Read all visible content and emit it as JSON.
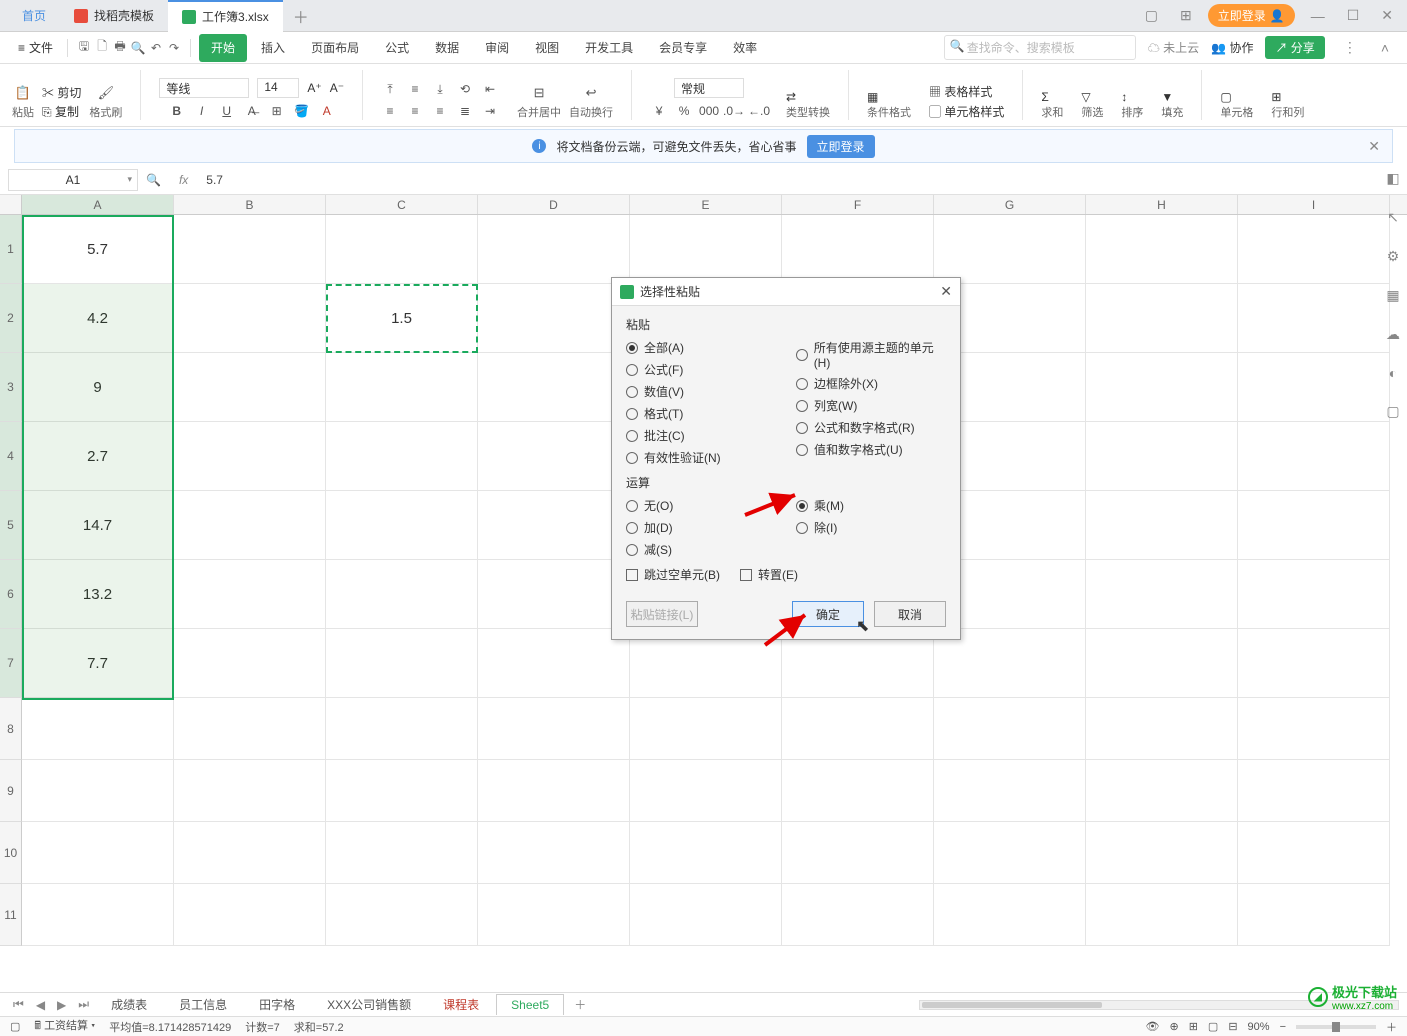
{
  "tabs": {
    "home": "首页",
    "templates": "找稻壳模板",
    "workbook": "工作簿3.xlsx",
    "login_pill": "立即登录"
  },
  "menu": {
    "file": "文件",
    "items": [
      "开始",
      "插入",
      "页面布局",
      "公式",
      "数据",
      "审阅",
      "视图",
      "开发工具",
      "会员专享",
      "效率"
    ],
    "active_index": 0,
    "search_placeholder": "查找命令、搜索模板",
    "cloud": "未上云",
    "collab": "协作",
    "share": "分享"
  },
  "ribbon": {
    "cut": "剪切",
    "copy": "复制",
    "paste": "粘贴",
    "format_painter": "格式刷",
    "font_name": "等线",
    "font_size": "14",
    "merge_center": "合并居中",
    "wrap": "自动换行",
    "number_format": "常规",
    "type_convert": "类型转换",
    "cond_format": "条件格式",
    "table_style": "表格样式",
    "cell_style": "单元格样式",
    "sum": "求和",
    "filter": "筛选",
    "sort": "排序",
    "fill": "填充",
    "cell": "单元格",
    "row_col": "行和列"
  },
  "tip": {
    "text": "将文档备份云端，可避免文件丢失，省心省事",
    "btn": "立即登录"
  },
  "fx": {
    "name_box": "A1",
    "value": "5.7"
  },
  "grid": {
    "cols": [
      "A",
      "B",
      "C",
      "D",
      "E",
      "F",
      "G",
      "H",
      "I"
    ],
    "rows": [
      1,
      2,
      3,
      4,
      5,
      6,
      7,
      8,
      9,
      10,
      11
    ],
    "data_a": [
      "5.7",
      "4.2",
      "9",
      "2.7",
      "14.7",
      "13.2",
      "7.7"
    ],
    "c2": "1.5"
  },
  "dialog": {
    "title": "选择性粘贴",
    "section_paste": "粘贴",
    "paste_left": [
      "全部(A)",
      "公式(F)",
      "数值(V)",
      "格式(T)",
      "批注(C)",
      "有效性验证(N)"
    ],
    "paste_right": [
      "所有使用源主题的单元(H)",
      "边框除外(X)",
      "列宽(W)",
      "公式和数字格式(R)",
      "值和数字格式(U)"
    ],
    "paste_checked": 0,
    "section_op": "运算",
    "op_left": [
      "无(O)",
      "加(D)",
      "减(S)"
    ],
    "op_right": [
      "乘(M)",
      "除(I)"
    ],
    "op_checked_col": "right",
    "op_checked_index": 0,
    "skip_blanks": "跳过空单元(B)",
    "transpose": "转置(E)",
    "paste_link": "粘贴链接(L)",
    "ok": "确定",
    "cancel": "取消"
  },
  "sheets": {
    "tabs": [
      "成绩表",
      "员工信息",
      "田字格",
      "XXX公司销售额",
      "课程表",
      "Sheet5"
    ],
    "active": 5,
    "highlight": 4
  },
  "status": {
    "calc": "工资结算",
    "avg_label": "平均值=",
    "avg": "8.171428571429",
    "count_label": "计数=",
    "count": "7",
    "sum_label": "求和=",
    "sum": "57.2",
    "zoom": "90%"
  },
  "watermark": {
    "brand": "极光下载站",
    "url": "www.xz7.com"
  }
}
